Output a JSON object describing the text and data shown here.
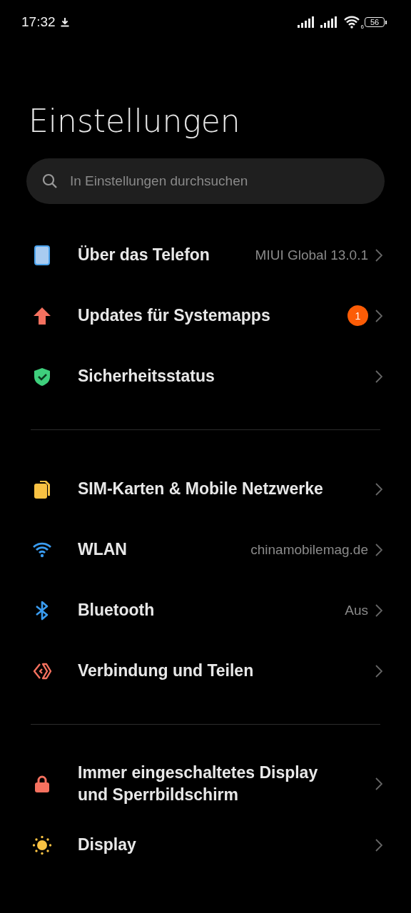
{
  "status_bar": {
    "time": "17:32",
    "wifi_standard": "6",
    "battery": "56"
  },
  "title": "Einstellungen",
  "search": {
    "placeholder": "In Einstellungen durchsuchen"
  },
  "sections": [
    {
      "items": [
        {
          "label": "Über das Telefon",
          "value": "MIUI Global 13.0.1"
        },
        {
          "label": "Updates für Systemapps",
          "badge": "1"
        },
        {
          "label": "Sicherheitsstatus"
        }
      ]
    },
    {
      "items": [
        {
          "label": "SIM-Karten & Mobile Netzwerke"
        },
        {
          "label": "WLAN",
          "value": "chinamobilemag.de"
        },
        {
          "label": "Bluetooth",
          "value": "Aus"
        },
        {
          "label": "Verbindung und Teilen"
        }
      ]
    },
    {
      "items": [
        {
          "label": "Immer eingeschaltetes Display und Sperrbildschirm"
        },
        {
          "label": "Display"
        }
      ]
    }
  ]
}
